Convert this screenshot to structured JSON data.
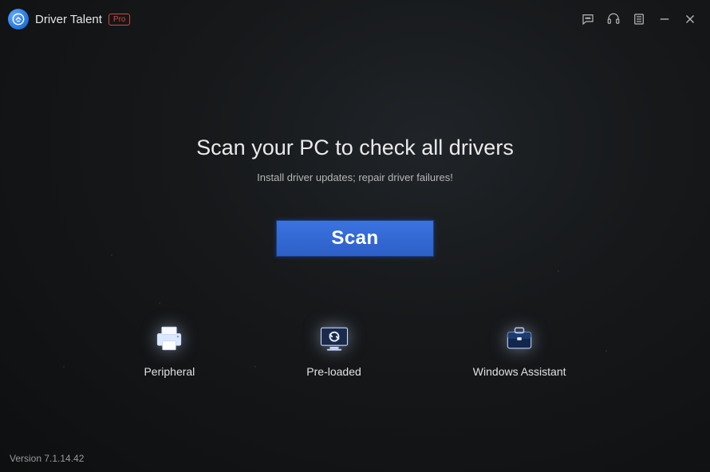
{
  "app": {
    "title": "Driver Talent",
    "pro_badge": "Pro",
    "version_label": "Version 7.1.14.42"
  },
  "main": {
    "headline": "Scan your PC to check all drivers",
    "subline": "Install driver updates; repair driver failures!",
    "scan_button": "Scan"
  },
  "tiles": [
    {
      "label": "Peripheral",
      "icon": "printer-icon"
    },
    {
      "label": "Pre-loaded",
      "icon": "preloaded-icon"
    },
    {
      "label": "Windows Assistant",
      "icon": "briefcase-icon"
    }
  ],
  "window_controls": {
    "feedback": "feedback",
    "support": "support",
    "menu": "menu",
    "minimize": "minimize",
    "close": "close"
  }
}
